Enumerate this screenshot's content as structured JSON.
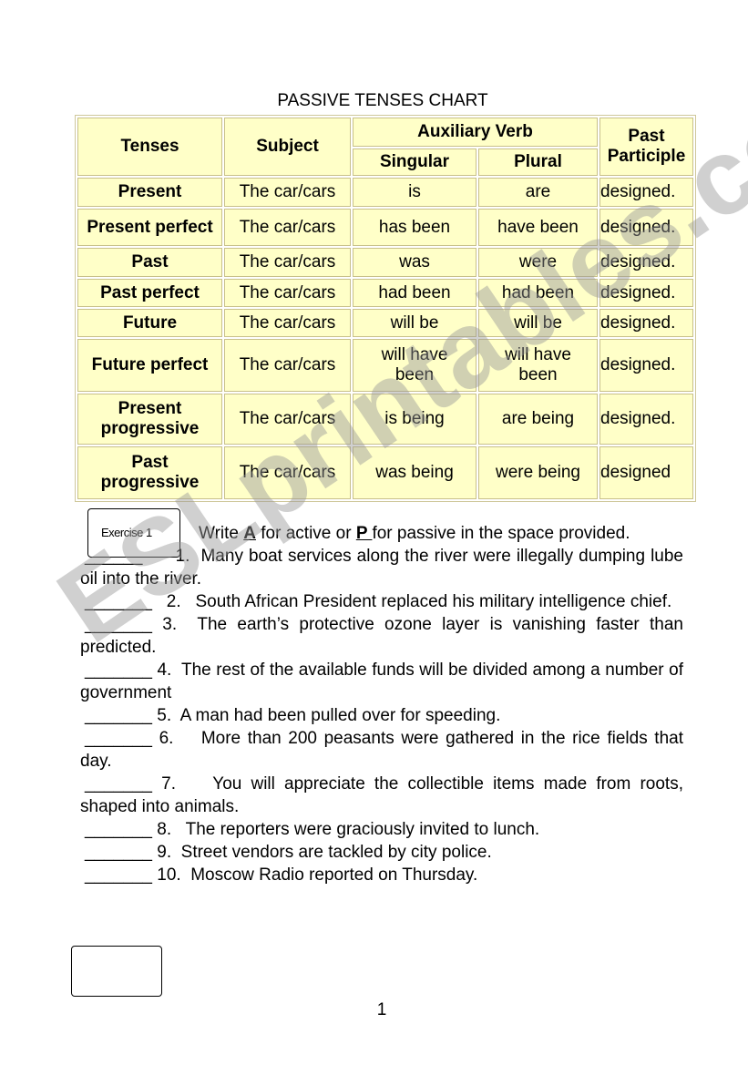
{
  "title": "PASSIVE TENSES CHART",
  "table": {
    "headers": {
      "tenses": "Tenses",
      "subject": "Subject",
      "aux": "Auxiliary Verb",
      "singular": "Singular",
      "plural": "Plural",
      "participle": "Past Participle"
    },
    "rows": [
      [
        "Present",
        "The car/cars",
        "is",
        "are",
        "designed."
      ],
      [
        "Present perfect",
        "The car/cars",
        "has been",
        "have been",
        "designed."
      ],
      [
        "Past",
        "The car/cars",
        "was",
        "were",
        "designed."
      ],
      [
        "Past perfect",
        "The car/cars",
        "had been",
        "had been",
        "designed."
      ],
      [
        "Future",
        "The car/cars",
        "will be",
        "will be",
        "designed."
      ],
      [
        "Future perfect",
        "The car/cars",
        "will have been",
        "will have been",
        "designed."
      ],
      [
        "Present progressive",
        "The car/cars",
        "is being",
        "are being",
        "designed."
      ],
      [
        "Past progressive",
        "The car/cars",
        "was being",
        "were being",
        "designed"
      ]
    ]
  },
  "exercise": {
    "label": "Exercise 1",
    "instr_pre": "Write ",
    "a": "A",
    "instr_mid": " for active or ",
    "p": "P ",
    "instr_post": "for passive in the space provided.",
    "items": [
      "______      1.  Many boat services along the river were illegally dumping lube oil into the river.",
      "_______   2.   South African President replaced his military intelligence chief.",
      "_______ 3.  The earth’s protective ozone layer is vanishing faster than predicted.",
      "_______ 4.  The rest of the available funds will be divided among a number of government",
      "_______ 5.  A man had been pulled over for speeding.",
      "_______ 6.    More than 200 peasants were gathered in the rice fields that day.",
      "_______ 7.    You will appreciate the collectible items made from roots, shaped into animals.",
      "_______ 8.   The reporters were graciously invited to lunch.",
      "_______ 9.  Street vendors are tackled by city police.",
      "_______ 10.  Moscow Radio reported on Thursday."
    ]
  },
  "watermark": "ESLprintables.com",
  "page_number": "1"
}
